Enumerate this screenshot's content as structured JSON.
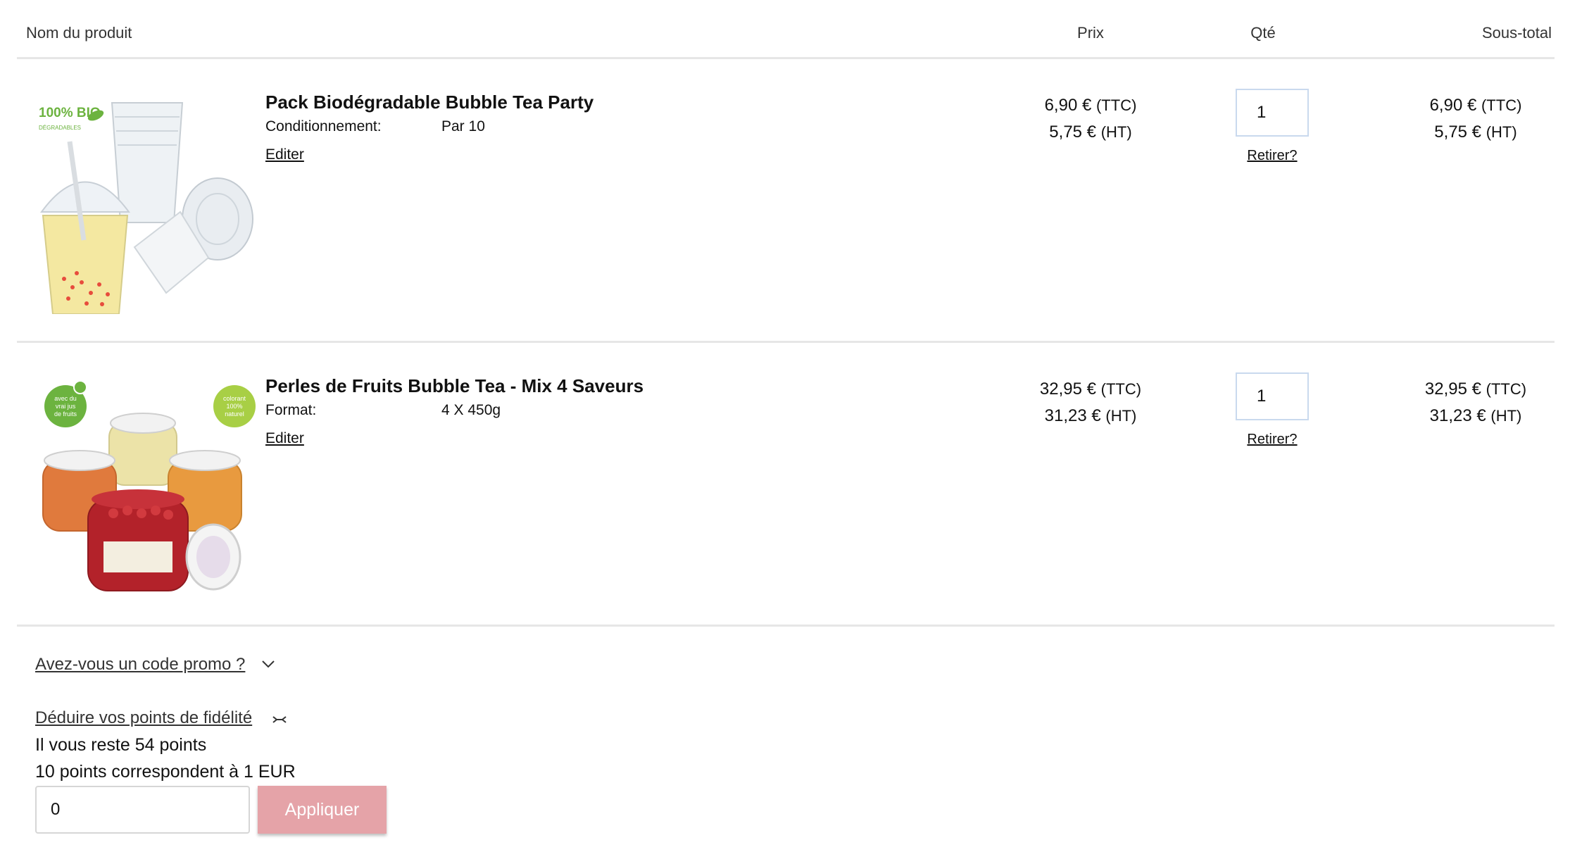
{
  "header": {
    "name": "Nom du produit",
    "price": "Prix",
    "qty": "Qté",
    "subtotal": "Sous-total"
  },
  "items": [
    {
      "name": "Pack Biodégradable Bubble Tea Party",
      "option_label": "Conditionnement:",
      "option_value": "Par 10",
      "edit": "Editer",
      "price_ttc": "6,90 €",
      "price_ht": "5,75 €",
      "qty": "1",
      "remove": "Retirer?",
      "subtotal_ttc": "6,90 €",
      "subtotal_ht": "5,75 €",
      "image_badge": "100% BIO",
      "image_badge_sub": "DÉGRADABLES",
      "image_icon": "cups-lids-straws-image"
    },
    {
      "name": "Perles de Fruits Bubble Tea - Mix 4 Saveurs",
      "option_label": "Format:",
      "option_value": "4 X 450g",
      "edit": "Editer",
      "price_ttc": "32,95 €",
      "price_ht": "31,23 €",
      "qty": "1",
      "remove": "Retirer?",
      "subtotal_ttc": "32,95 €",
      "subtotal_ht": "31,23 €",
      "badge_left": [
        "avec du",
        "vrai jus",
        "de fruits"
      ],
      "badge_right": [
        "colorant",
        "100%",
        "naturel"
      ],
      "image_icon": "fruit-pearl-jars-image"
    }
  ],
  "suffix_ttc": "(TTC)",
  "suffix_ht": "(HT)",
  "promo": {
    "label": "Avez-vous un code promo ?",
    "icon": "chevron-down-icon"
  },
  "loyalty": {
    "link": "Déduire vos points de fidélité",
    "icon": "collapse-arrows-icon",
    "remaining": "Il vous reste 54 points",
    "ratio": "10 points correspondent à 1 EUR",
    "input_value": "0",
    "apply": "Appliquer",
    "apply_color": "#e5a3a8"
  }
}
